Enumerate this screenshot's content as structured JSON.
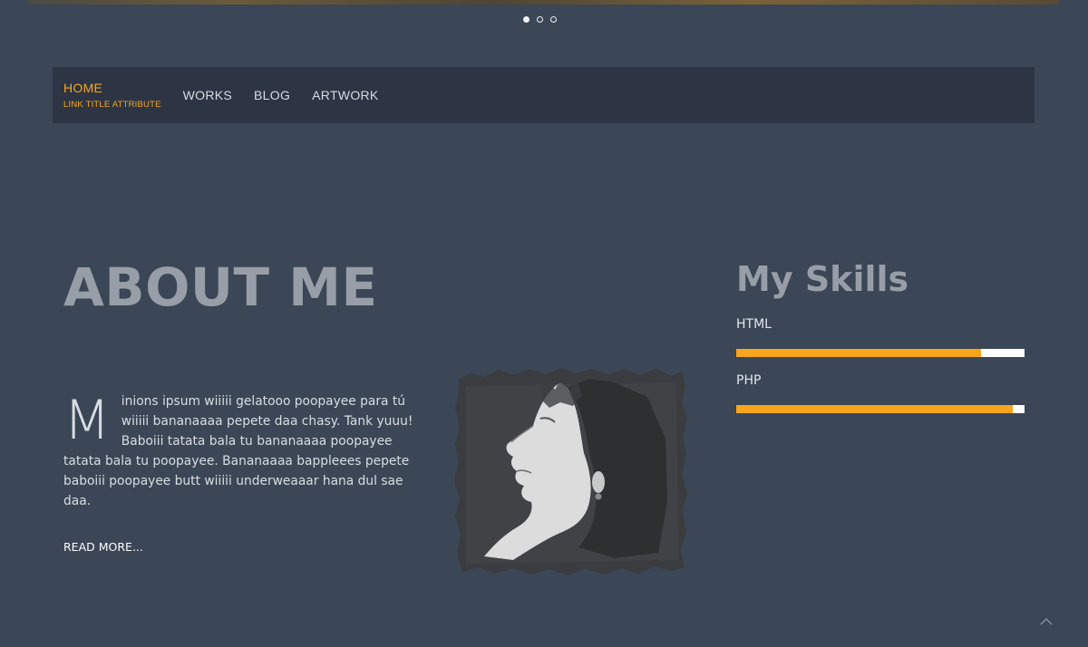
{
  "slider": {
    "dots": [
      "slide-1",
      "slide-2",
      "slide-3"
    ],
    "active_index": 0
  },
  "nav": {
    "home_label": "HOME",
    "home_subtitle": "LINK TITLE ATTRIBUTE",
    "works_label": "WORKS",
    "blog_label": "BLOG",
    "artwork_label": "ARTWORK"
  },
  "about": {
    "title": "ABOUT ME",
    "dropcap": "M",
    "body": "inions ipsum wiiiii gelatooo poopayee para tú wiiiii bananaaaa pepete daa chasy. Tank yuuu! Baboiii tatata bala tu bananaaaa poopayee tatata bala tu poopayee. Bananaaaa bappleees pepete baboiii poopayee butt wiiiii underweaaar hana dul sae daa.",
    "read_more": "READ MORE..."
  },
  "skills": {
    "title": "My Skills",
    "items": [
      {
        "label": "HTML",
        "percent": 85
      },
      {
        "label": "PHP",
        "percent": 96
      }
    ]
  },
  "colors": {
    "background": "#3b4656",
    "navbar": "#2d3544",
    "accent": "#f6a51c",
    "heading": "#989ea7"
  },
  "icons": {
    "back_to_top": "chevron-up-icon"
  }
}
